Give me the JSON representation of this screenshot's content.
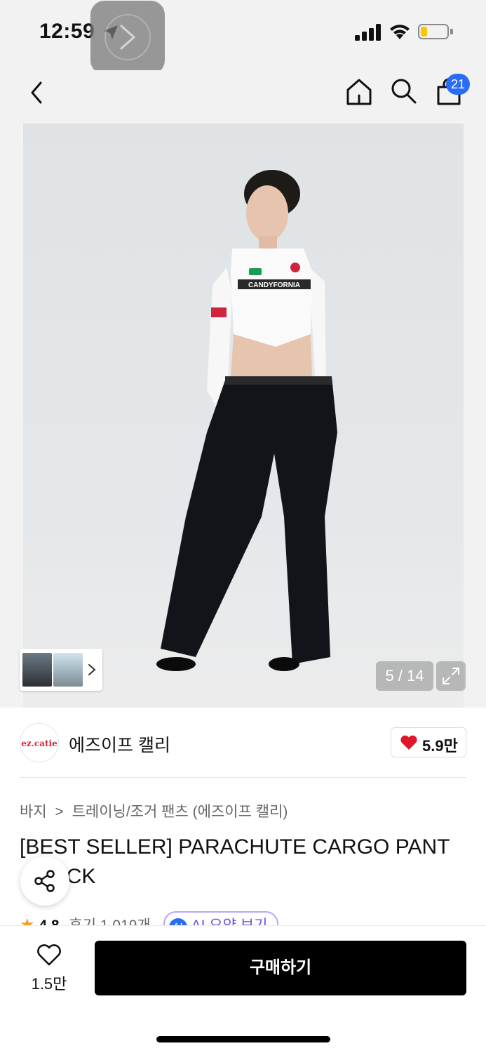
{
  "status_bar": {
    "time": "12:59",
    "battery_level": 0.25,
    "icons": [
      "location-arrow-icon",
      "signal-icon",
      "wifi-icon",
      "battery-icon"
    ]
  },
  "nav": {
    "icons": [
      "back-icon",
      "home-icon",
      "search-icon",
      "shopping-bag-icon"
    ],
    "cart_badge": "21"
  },
  "gallery": {
    "counter": "5 / 14",
    "current": 5,
    "total": 14,
    "shirt_print": "CANDYFORNIA"
  },
  "brand": {
    "logo_text": "ez.catie",
    "name": "에즈이프 캘리",
    "likes": "5.9만"
  },
  "breadcrumb": {
    "category": "바지",
    "separator": ">",
    "subcategory": "트레이닝/조거 팬츠 (에즈이프 캘리)"
  },
  "product": {
    "title": "[BEST SELLER] PARACHUTE CARGO PANT (BLACK"
  },
  "rating": {
    "star": "★",
    "score": "4.8",
    "reviews": "후기 1,019개",
    "ai_badge": "AI",
    "ai_summary": "AI 요약 보기"
  },
  "bottom_bar": {
    "wish_count": "1.5만",
    "buy_label": "구매하기"
  },
  "colors": {
    "accent_blue": "#2a6df4",
    "heart_red": "#e0152b",
    "star_orange": "#f4a028",
    "buy_black": "#000000"
  }
}
